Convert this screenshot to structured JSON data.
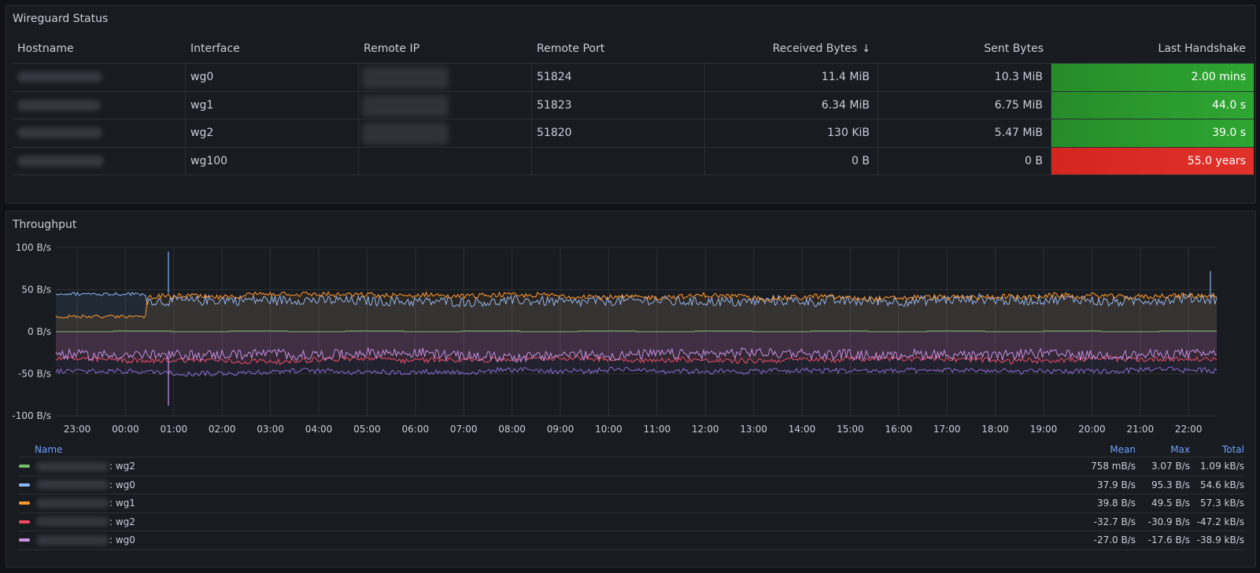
{
  "status_panel": {
    "title": "Wireguard Status",
    "columns": [
      "Hostname",
      "Interface",
      "Remote IP",
      "Remote Port",
      "Received Bytes",
      "Sent Bytes",
      "Last Handshake"
    ],
    "sort_arrow": "↓",
    "rows": [
      {
        "interface": "wg0",
        "port": "51824",
        "received": "11.4 MiB",
        "sent": "10.3 MiB",
        "handshake": "2.00 mins",
        "status": "green"
      },
      {
        "interface": "wg1",
        "port": "51823",
        "received": "6.34 MiB",
        "sent": "6.75 MiB",
        "handshake": "44.0 s",
        "status": "green"
      },
      {
        "interface": "wg2",
        "port": "51820",
        "received": "130 KiB",
        "sent": "5.47 MiB",
        "handshake": "39.0 s",
        "status": "green"
      },
      {
        "interface": "wg100",
        "port": "",
        "received": "0 B",
        "sent": "0 B",
        "handshake": "55.0 years",
        "status": "red"
      }
    ],
    "colors": {
      "green": "#2ea632",
      "red": "#e0312a"
    }
  },
  "throughput_panel": {
    "title": "Throughput",
    "legend": {
      "headers": {
        "name": "Name",
        "mean": "Mean",
        "max": "Max",
        "total": "Total"
      },
      "rows": [
        {
          "label": ": wg2",
          "color": "#73bf69",
          "mean": "758 mB/s",
          "max": "3.07 B/s",
          "total": "1.09 kB/s"
        },
        {
          "label": ": wg0",
          "color": "#8ab8ff",
          "mean": "37.9 B/s",
          "max": "95.3 B/s",
          "total": "54.6 kB/s"
        },
        {
          "label": ": wg1",
          "color": "#ff9830",
          "mean": "39.8 B/s",
          "max": "49.5 B/s",
          "total": "57.3 kB/s"
        },
        {
          "label": ": wg2",
          "color": "#f2495c",
          "mean": "-32.7 B/s",
          "max": "-30.9 B/s",
          "total": "-47.2 kB/s"
        },
        {
          "label": ": wg0",
          "color": "#ca95e5",
          "mean": "-27.0 B/s",
          "max": "-17.6 B/s",
          "total": "-38.9 kB/s"
        }
      ]
    }
  },
  "chart_data": {
    "type": "line",
    "y_ticks": [
      "100 B/s",
      "50 B/s",
      "0 B/s",
      "-50 B/s",
      "-100 B/s"
    ],
    "ylim": [
      -100,
      100
    ],
    "x_ticks": [
      "23:00",
      "00:00",
      "01:00",
      "02:00",
      "03:00",
      "04:00",
      "05:00",
      "06:00",
      "07:00",
      "08:00",
      "09:00",
      "10:00",
      "11:00",
      "12:00",
      "13:00",
      "14:00",
      "15:00",
      "16:00",
      "17:00",
      "18:00",
      "19:00",
      "20:00",
      "21:00",
      "22:00"
    ],
    "grid": true,
    "series": [
      {
        "color": "#73bf69",
        "level": 1,
        "noise": 0.5,
        "type": "bursty"
      },
      {
        "color": "#8ab8ff",
        "level": 37,
        "noise": 6
      },
      {
        "color": "#ff9830",
        "level": 42,
        "noise": 3
      },
      {
        "color": "#f2495c",
        "level": -33,
        "noise": 3
      },
      {
        "color": "#ca95e5",
        "level": -27,
        "noise": 6
      },
      {
        "color": "#8f6bd6",
        "level": -47,
        "noise": 3
      }
    ]
  }
}
